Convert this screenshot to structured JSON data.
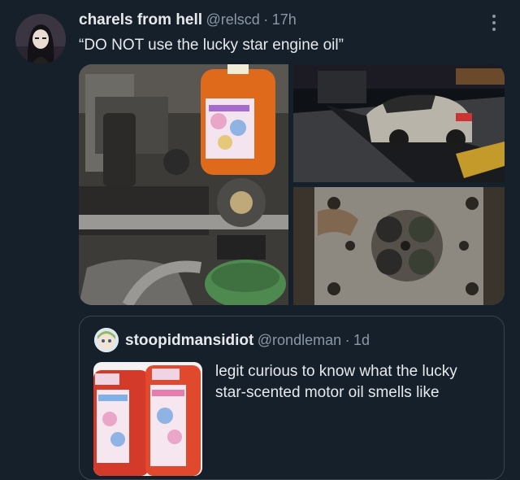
{
  "tweet": {
    "author_name": "charels from hell",
    "author_handle": "@relscd",
    "separator": "·",
    "time": "17h",
    "text": "“DO NOT use the lucky star engine oil”",
    "media_labels": {
      "bottle": "Lucky Star engine oil bottle",
      "tow": "Car on a tow truck",
      "engine": "Damaged cylinder head"
    }
  },
  "quoted_tweet": {
    "author_name": "stoopidmansidiot",
    "author_handle": "@rondleman",
    "separator": "·",
    "time": "1d",
    "text": "legit curious to know what the lucky star-scented motor oil smells like"
  },
  "colors": {
    "background": "#15202b",
    "text_primary": "#e7e9ea",
    "text_secondary": "#8b98a5",
    "border": "#38444d"
  },
  "icons": [
    "more-icon"
  ]
}
